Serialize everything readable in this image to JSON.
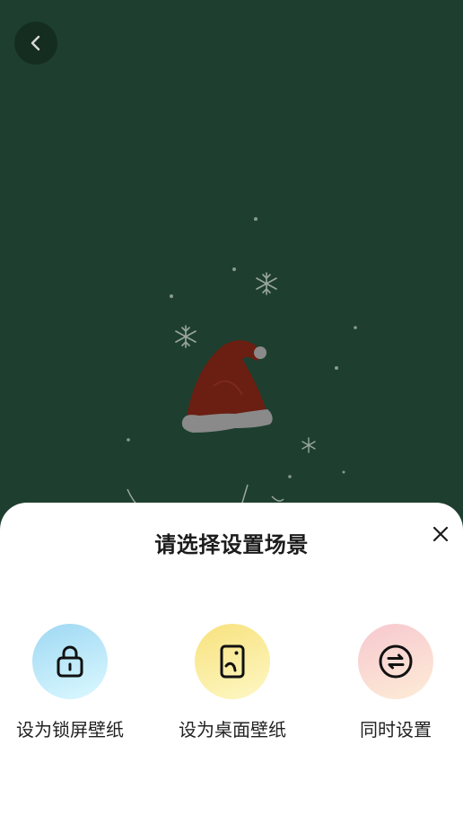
{
  "navigation": {
    "back_icon": "chevron-left-icon"
  },
  "sheet": {
    "title": "请选择设置场景",
    "close_icon": "close-icon",
    "options": [
      {
        "label": "设为锁屏壁纸",
        "icon": "lock-icon",
        "gradient_from": "#9ed8f3",
        "gradient_to": "#dcf9ff"
      },
      {
        "label": "设为桌面壁纸",
        "icon": "phone-screen-icon",
        "gradient_from": "#f8e27e",
        "gradient_to": "#fdf7c4"
      },
      {
        "label": "同时设置",
        "icon": "swap-arrows-icon",
        "gradient_from": "#f7c8d0",
        "gradient_to": "#fdecd6"
      }
    ]
  },
  "colors": {
    "wallpaper_background": "#1e3f2f",
    "hat_red": "#6b1e12",
    "hat_fur": "#8a8a8a",
    "sheet_background": "#ffffff",
    "text_primary": "#1c1c1c"
  }
}
